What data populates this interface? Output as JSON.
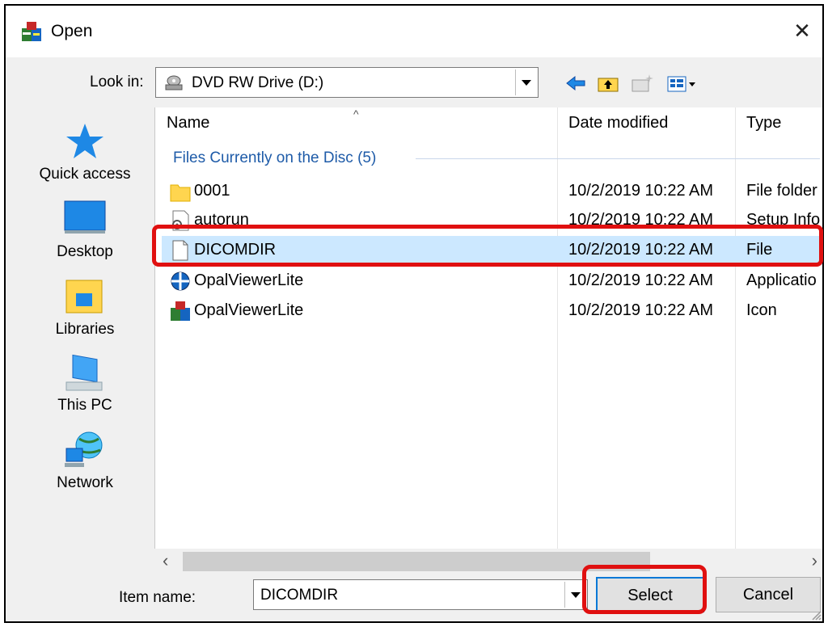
{
  "window": {
    "title": "Open",
    "close_label": "✕"
  },
  "lookin": {
    "label": "Look in:",
    "value": "DVD RW Drive (D:)"
  },
  "toolbar": {
    "back_icon": "back-arrow-icon",
    "up_icon": "up-folder-icon",
    "new_folder_icon": "new-folder-icon",
    "view_icon": "view-menu-icon"
  },
  "places": [
    {
      "label": "Quick access",
      "icon": "star-icon"
    },
    {
      "label": "Desktop",
      "icon": "desktop-icon"
    },
    {
      "label": "Libraries",
      "icon": "libraries-icon"
    },
    {
      "label": "This PC",
      "icon": "computer-icon"
    },
    {
      "label": "Network",
      "icon": "network-icon"
    }
  ],
  "filelist": {
    "columns": [
      "Name",
      "Date modified",
      "Type"
    ],
    "group_title": "Files Currently on the Disc (5)",
    "rows": [
      {
        "name": "0001",
        "date": "10/2/2019 10:22 AM",
        "type": "File folder",
        "icon": "folder-icon"
      },
      {
        "name": "autorun",
        "date": "10/2/2019 10:22 AM",
        "type": "Setup Info",
        "icon": "settings-file-icon"
      },
      {
        "name": "DICOMDIR",
        "date": "10/2/2019 10:22 AM",
        "type": "File",
        "icon": "blank-file-icon",
        "selected": true
      },
      {
        "name": "OpalViewerLite",
        "date": "10/2/2019 10:22 AM",
        "type": "Applicatio",
        "icon": "application-icon"
      },
      {
        "name": "OpalViewerLite",
        "date": "10/2/2019 10:22 AM",
        "type": "Icon",
        "icon": "app-logo-icon"
      }
    ]
  },
  "scroll": {
    "left": "‹",
    "right": "›"
  },
  "itemname": {
    "label": "Item name:",
    "value": "DICOMDIR"
  },
  "buttons": {
    "select": "Select",
    "cancel": "Cancel"
  },
  "colors": {
    "selection": "#cce8ff",
    "highlight": "#e01010",
    "group_text": "#1e5ba8"
  }
}
